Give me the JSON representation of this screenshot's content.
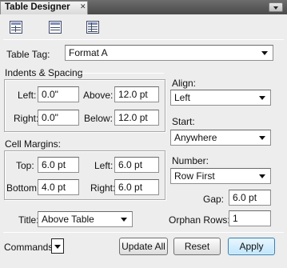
{
  "panel": {
    "title": "Table Designer",
    "close_glyph": "✕"
  },
  "toolbar": {
    "icons": [
      "table-properties-icon",
      "table-row-properties-icon",
      "table-ruling-icon"
    ]
  },
  "table_tag": {
    "label": "Table Tag:",
    "value": "Format A"
  },
  "indents": {
    "heading": "Indents & Spacing",
    "left_label": "Left:",
    "left_value": "0.0\"",
    "right_label": "Right:",
    "right_value": "0.0\"",
    "above_label": "Above:",
    "above_value": "12.0 pt",
    "below_label": "Below:",
    "below_value": "12.0 pt"
  },
  "align": {
    "label": "Align:",
    "value": "Left"
  },
  "start": {
    "label": "Start:",
    "value": "Anywhere"
  },
  "cell_margins": {
    "heading": "Cell Margins:",
    "top_label": "Top:",
    "top_value": "6.0 pt",
    "bottom_label": "Bottom:",
    "bottom_value": "4.0 pt",
    "left_label": "Left:",
    "left_value": "6.0 pt",
    "right_label": "Right:",
    "right_value": "6.0 pt"
  },
  "numbering": {
    "label": "Number:",
    "value": "Row First"
  },
  "gap": {
    "label": "Gap:",
    "value": "6.0 pt"
  },
  "title_position": {
    "label": "Title:",
    "value": "Above Table"
  },
  "orphan_rows": {
    "label": "Orphan Rows:",
    "value": "1"
  },
  "commands": {
    "label": "Commands:"
  },
  "buttons": {
    "update_all": "Update All",
    "reset": "Reset",
    "apply": "Apply"
  },
  "colors": {
    "panel_bg": "#ededed",
    "apply_accent": "#3c7fb1"
  }
}
